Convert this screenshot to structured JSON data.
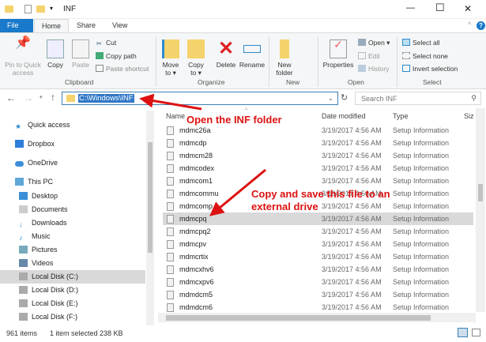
{
  "window": {
    "title": "INF",
    "minimize": "—",
    "maximize": "☐",
    "close": "✕"
  },
  "tabs": [
    "File",
    "Home",
    "Share",
    "View"
  ],
  "ribbon": {
    "clipboard": {
      "pin": "Pin to Quick access",
      "copy": "Copy",
      "paste": "Paste",
      "cut": "Cut",
      "copy_path": "Copy path",
      "paste_shortcut": "Paste shortcut",
      "label": "Clipboard"
    },
    "organize": {
      "move_to": "Move to ▾",
      "copy_to": "Copy to ▾",
      "delete": "Delete",
      "rename": "Rename",
      "label": "Organize"
    },
    "new": {
      "new_folder": "New folder",
      "label": "New"
    },
    "open": {
      "properties": "Properties",
      "open": "Open ▾",
      "edit": "Edit",
      "history": "History",
      "label": "Open"
    },
    "select": {
      "select_all": "Select all",
      "select_none": "Select none",
      "invert": "Invert selection",
      "label": "Select"
    }
  },
  "address": {
    "path": "C:\\Windows\\INF",
    "search_placeholder": "Search INF"
  },
  "sidebar": [
    "Quick access",
    "Dropbox",
    "OneDrive",
    "This PC",
    "Desktop",
    "Documents",
    "Downloads",
    "Music",
    "Pictures",
    "Videos",
    "Local Disk (C:)",
    "Local Disk (D:)",
    "Local Disk (E:)",
    "Local Disk (F:)"
  ],
  "columns": {
    "name": "Name",
    "date": "Date modified",
    "type": "Type",
    "size": "Siz"
  },
  "files": [
    {
      "name": "mdmc26a",
      "date": "3/19/2017 4:56 AM",
      "type": "Setup Information"
    },
    {
      "name": "mdmcdp",
      "date": "3/19/2017 4:56 AM",
      "type": "Setup Information"
    },
    {
      "name": "mdmcm28",
      "date": "3/19/2017 4:56 AM",
      "type": "Setup Information"
    },
    {
      "name": "mdmcodex",
      "date": "3/19/2017 4:56 AM",
      "type": "Setup Information"
    },
    {
      "name": "mdmcom1",
      "date": "3/19/2017 4:56 AM",
      "type": "Setup Information"
    },
    {
      "name": "mdmcommu",
      "date": "3/19/2017 4:56 AM",
      "type": "Setup Information"
    },
    {
      "name": "mdmcomp",
      "date": "3/19/2017 4:56 AM",
      "type": "Setup Information"
    },
    {
      "name": "mdmcpq",
      "date": "3/19/2017 4:56 AM",
      "type": "Setup Information"
    },
    {
      "name": "mdmcpq2",
      "date": "3/19/2017 4:56 AM",
      "type": "Setup Information"
    },
    {
      "name": "mdmcpv",
      "date": "3/19/2017 4:56 AM",
      "type": "Setup Information"
    },
    {
      "name": "mdmcrtix",
      "date": "3/19/2017 4:56 AM",
      "type": "Setup Information"
    },
    {
      "name": "mdmcxhv6",
      "date": "3/19/2017 4:56 AM",
      "type": "Setup Information"
    },
    {
      "name": "mdmcxpv6",
      "date": "3/19/2017 4:56 AM",
      "type": "Setup Information"
    },
    {
      "name": "mdmdcm5",
      "date": "3/19/2017 4:56 AM",
      "type": "Setup Information"
    },
    {
      "name": "mdmdcm6",
      "date": "3/19/2017 4:56 AM",
      "type": "Setup Information"
    }
  ],
  "selected_index": 7,
  "annotations": {
    "open": "Open the INF folder",
    "copy_line1": "Copy and save this file to an",
    "copy_line2": "external drive"
  },
  "status": {
    "items": "961 items",
    "selected": "1 item selected  238 KB"
  },
  "colors": {
    "accent": "#1979ca",
    "annotation": "#d11111",
    "selection": "#d9d9d9"
  }
}
